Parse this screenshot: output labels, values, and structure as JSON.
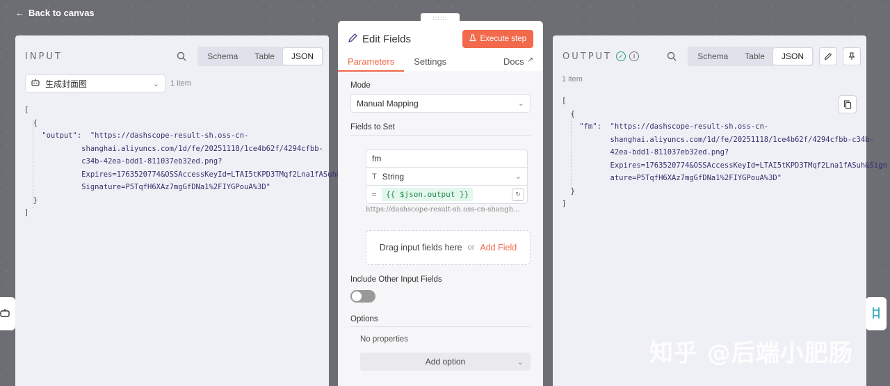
{
  "nav": {
    "back_label": "Back to canvas"
  },
  "drag_handle": "::::::",
  "input_panel": {
    "title": "INPUT",
    "view_tabs": [
      "Schema",
      "Table",
      "JSON"
    ],
    "active_view": "JSON",
    "node_select": "生成封面图",
    "item_count": "1 item",
    "json_lines": [
      "[",
      "  {",
      "    \"output\":  \"https://dashscope-result-sh.oss-cn-",
      "             shanghai.aliyuncs.com/1d/fe/20251118/1ce4b62f/4294cfbb-",
      "             c34b-42ea-bdd1-811037eb32ed.png?",
      "             Expires=1763520774&OSSAccessKeyId=LTAI5tKPD3TMqf2Lna1fASuh&",
      "             Signature=P5TqfH6XAz7mgGfDNa1%2FIYGPouA%3D\"",
      "  }",
      "]"
    ]
  },
  "output_panel": {
    "title": "OUTPUT",
    "view_tabs": [
      "Schema",
      "Table",
      "JSON"
    ],
    "active_view": "JSON",
    "item_count": "1 item",
    "json_lines": [
      "[",
      "  {",
      "    \"fm\":  \"https://dashscope-result-sh.oss-cn-",
      "           shanghai.aliyuncs.com/1d/fe/20251118/1ce4b62f/4294cfbb-c34b-",
      "           42ea-bdd1-811037eb32ed.png?",
      "           Expires=1763520774&OSSAccessKeyId=LTAI5tKPD3TMqf2Lna1fASuh&Sign",
      "           ature=P5TqfH6XAz7mgGfDNa1%2FIYGPouA%3D\"",
      "  }",
      "]"
    ]
  },
  "center": {
    "title": "Edit Fields",
    "execute_label": "Execute step",
    "tabs": {
      "parameters": "Parameters",
      "settings": "Settings",
      "docs": "Docs"
    },
    "mode_label": "Mode",
    "mode_value": "Manual Mapping",
    "fields_label": "Fields to Set",
    "field": {
      "name": "fm",
      "type": "String",
      "eq": "=",
      "expression": "{{ $json.output }}",
      "preview": "https://dashscope-result-sh.oss-cn-shangh…"
    },
    "drop_text": "Drag input fields here",
    "drop_or": "or",
    "add_field": "Add Field",
    "include_label": "Include Other Input Fields",
    "options_label": "Options",
    "no_properties": "No properties",
    "add_option": "Add option"
  },
  "watermark": "知乎 @后端小肥肠"
}
